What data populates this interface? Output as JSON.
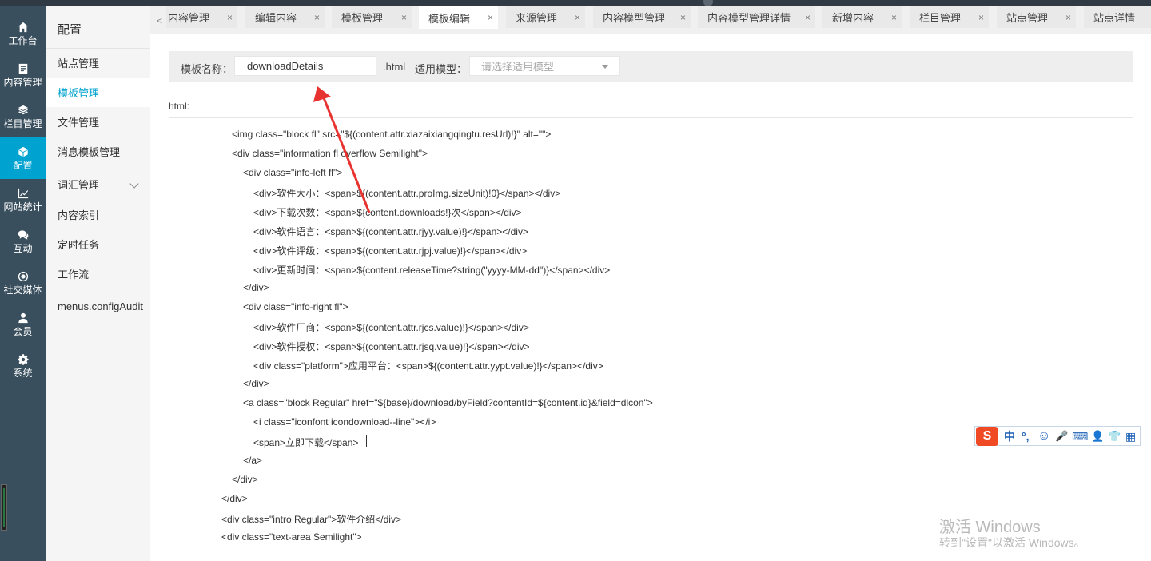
{
  "rail": [
    {
      "label": "工作台",
      "icon": "home-icon",
      "active": false
    },
    {
      "label": "内容管理",
      "icon": "document-icon",
      "active": false
    },
    {
      "label": "栏目管理",
      "icon": "layers-icon",
      "active": false
    },
    {
      "label": "配置",
      "icon": "cube-icon",
      "active": true
    },
    {
      "label": "网站统计",
      "icon": "chart-icon",
      "active": false
    },
    {
      "label": "互动",
      "icon": "chat-icon",
      "active": false
    },
    {
      "label": "社交媒体",
      "icon": "target-icon",
      "active": false
    },
    {
      "label": "会员",
      "icon": "user-icon",
      "active": false
    },
    {
      "label": "系统",
      "icon": "gear-icon",
      "active": false
    }
  ],
  "submenu": {
    "title": "配置",
    "items": [
      {
        "label": "站点管理"
      },
      {
        "label": "模板管理",
        "active": true
      },
      {
        "label": "文件管理"
      },
      {
        "label": "消息模板管理"
      },
      {
        "label": "词汇管理",
        "expandable": true
      },
      {
        "label": "内容索引"
      },
      {
        "label": "定时任务"
      },
      {
        "label": "工作流"
      },
      {
        "label": "menus.configAudit"
      }
    ]
  },
  "tabs": [
    {
      "label": "内容管理"
    },
    {
      "label": "编辑内容"
    },
    {
      "label": "模板管理"
    },
    {
      "label": "模板编辑",
      "active": true
    },
    {
      "label": "来源管理"
    },
    {
      "label": "内容模型管理"
    },
    {
      "label": "内容模型管理详情"
    },
    {
      "label": "新增内容"
    },
    {
      "label": "栏目管理"
    },
    {
      "label": "站点管理"
    },
    {
      "label": "站点详情"
    }
  ],
  "tab_close": "×",
  "tab_scroll_left": "<",
  "form": {
    "name_label": "模板名称：",
    "name_value": "downloadDetails",
    "suffix": ".html",
    "model_label": "适用模型：",
    "model_placeholder": "请选择适用模型"
  },
  "html_label": "html:",
  "code_lines": [
    "<img class=\"block fl\" src=\"${(content.attr.xiazaixiangqingtu.resUrl)!}\" alt=\"\">",
    "<div class=\"information fl overflow Semilight\">",
    "<div class=\"info-left fl\">",
    "<div>软件大小：<span>${(content.attr.proImg.sizeUnit)!0}</span></div>",
    "<div>下载次数：<span>${content.downloads!}次</span></div>",
    "<div>软件语言：<span>${(content.attr.rjyy.value)!}</span></div>",
    "<div>软件评级：<span>${(content.attr.rjpj.value)!}</span></div>",
    "<div>更新时间：<span>${content.releaseTime?string(\"yyyy-MM-dd\")}</span></div>",
    "</div>",
    "<div class=\"info-right fl\">",
    "<div>软件厂商：<span>${(content.attr.rjcs.value)!}</span></div>",
    "<div>软件授权：<span>${(content.attr.rjsq.value)!}</span></div>",
    "<div class=\"platform\">应用平台：<span>${(content.attr.yypt.value)!}</span></div>",
    "</div>",
    "<a class=\"block Regular\" href=\"${base}/download/byField?contentId=${content.id}&field=dlcon\">",
    "<i class=\"iconfont icondownload--line\"></i>",
    "<span>立即下载</span>",
    "</a>",
    "</div>",
    "</div>",
    "<div class=\"intro Regular\">软件介绍</div>",
    "<div class=\"text-area Semilight\">"
  ],
  "ime": {
    "logo": "S",
    "buttons": [
      "中",
      "°,",
      "☺",
      "🎤",
      "⌨",
      "👤",
      "👕",
      "▦"
    ]
  },
  "watermark": {
    "line1": "激活 Windows",
    "line2": "转到\"设置\"以激活 Windows。"
  },
  "colors": {
    "rail_bg": "#3a4f5e",
    "accent": "#00a3cf",
    "arrow": "#e8322f"
  }
}
